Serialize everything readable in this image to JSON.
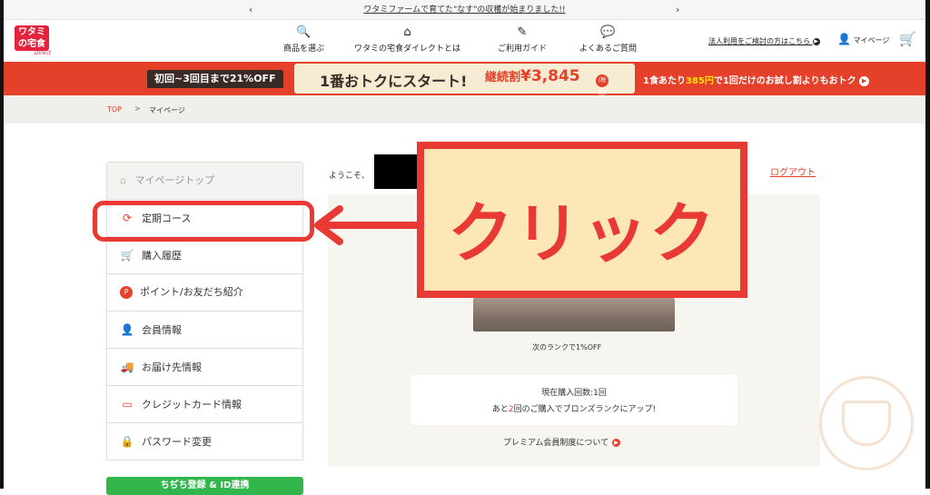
{
  "announcement": {
    "text": "ワタミファームで育てた\"なす\"の収穫が始まりました!!",
    "prev": "‹",
    "next": "›"
  },
  "header": {
    "logo_line1": "ワタミ",
    "logo_line2": "の宅食",
    "logo_sub": "Direct",
    "nav": [
      {
        "label": "商品を選ぶ",
        "icon": "search-icon",
        "glyph": "🔍"
      },
      {
        "label": "ワタミの宅食ダイレクトとは",
        "icon": "home-icon",
        "glyph": "⌂"
      },
      {
        "label": "ご利用ガイド",
        "icon": "guide-icon",
        "glyph": "✎"
      },
      {
        "label": "よくあるご質問",
        "icon": "faq-icon",
        "glyph": "💬"
      }
    ],
    "business_link": "法人利用をご検討の方はこちら",
    "mypage_label": "マイページ",
    "cart_glyph": "🛒"
  },
  "banner": {
    "pill": "初回~3回目まで21%OFF",
    "main": "1番おトクにスタート!",
    "discount_label": "継続割",
    "discount_price": "¥3,845",
    "tax_label": "(税込)",
    "right_prefix": "1食あたり",
    "right_price": "385円",
    "right_suffix": "で1回だけのお試し割よりもおトク"
  },
  "breadcrumb": {
    "top": "TOP",
    "sep": ">",
    "current": "マイページ"
  },
  "sidebar": {
    "top_label": "マイページトップ",
    "items": [
      {
        "label": "定期コース",
        "icon": "refresh-icon",
        "glyph": "⟳"
      },
      {
        "label": "購入履歴",
        "icon": "cart-icon",
        "glyph": "🛒"
      },
      {
        "label": "ポイント/お友だち紹介",
        "icon": "point-icon",
        "glyph": "P"
      },
      {
        "label": "会員情報",
        "icon": "person-icon",
        "glyph": "👤"
      },
      {
        "label": "お届け先情報",
        "icon": "truck-icon",
        "glyph": "🚚"
      },
      {
        "label": "クレジットカード情報",
        "icon": "card-icon",
        "glyph": "▭"
      },
      {
        "label": "パスワード変更",
        "icon": "lock-icon",
        "glyph": "🔒"
      }
    ],
    "green_button": "ちぢち登録 & ID連携"
  },
  "content": {
    "welcome": "ようこそ、",
    "logout": "ログアウト",
    "next_rank": "次のランクで1%OFF",
    "count_line": "現在購入回数:1回",
    "promo_prefix": "あと",
    "promo_num": "2",
    "promo_suffix": "回のご購入でブロンズランクにアップ!",
    "premium_link": "プレミアム会員制度について"
  },
  "overlay": {
    "callout": "クリック"
  },
  "colors": {
    "brand_red": "#e4402a",
    "annotation_red": "#e93935",
    "callout_bg": "#fde7b6",
    "green": "#32b64b"
  }
}
